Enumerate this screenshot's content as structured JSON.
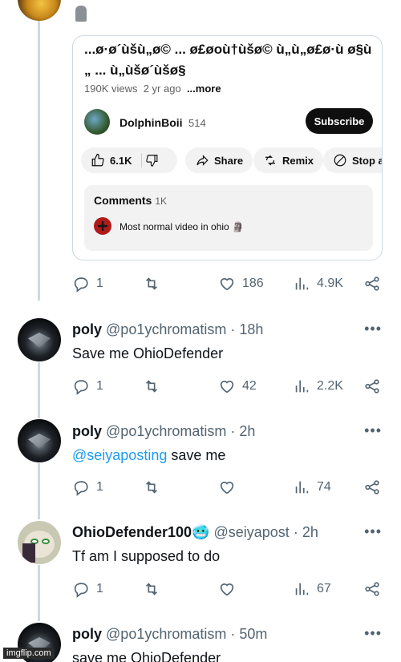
{
  "top_badge_icon": "moai-emoji",
  "card": {
    "title": "...ø·ø´ùšù„ø© ... ø£øoù†ùšø© ù„ù„ø£ø·ù ø§ù„ ... ù„ùšø´ùšø§",
    "views": "190K views",
    "age": "2 yr ago",
    "more": "...more",
    "channel": "DolphinBoii",
    "subs": "514",
    "subscribe": "Subscribe",
    "likes": "6.1K",
    "share": "Share",
    "remix": "Remix",
    "stop": "Stop ad",
    "comments_label": "Comments",
    "comments_count": "1K",
    "top_comment": "Most normal video in ohio 🗿"
  },
  "post0": {
    "replies": "1",
    "retweets": "",
    "likes": "186",
    "views": "4.9K"
  },
  "replies": [
    {
      "name": "poly",
      "handle": "@po1ychromatism",
      "time": "· 18h",
      "text": "Save me OhioDefender",
      "mention": "",
      "replies": "1",
      "likes": "42",
      "views": "2.2K"
    },
    {
      "name": "poly",
      "handle": "@po1ychromatism",
      "time": "· 2h",
      "text": "save me",
      "mention": "@seiyaposting",
      "replies": "1",
      "likes": "",
      "views": "74"
    },
    {
      "name": "OhioDefender100",
      "emoji": "🥶",
      "handle": "@seiyapost",
      "time": "· 2h",
      "text": "Tf am I supposed to do",
      "mention": "",
      "replies": "1",
      "likes": "",
      "views": "67"
    },
    {
      "name": "poly",
      "handle": "@po1ychromatism",
      "time": "· 50m",
      "text": "save me OhioDefender",
      "mention": "",
      "replies": "",
      "likes": "",
      "views": ""
    }
  ],
  "watermark": "imgflip.com",
  "colors": {
    "accent": "#1d9bf0",
    "muted": "#536471",
    "line": "#cfd9de"
  }
}
